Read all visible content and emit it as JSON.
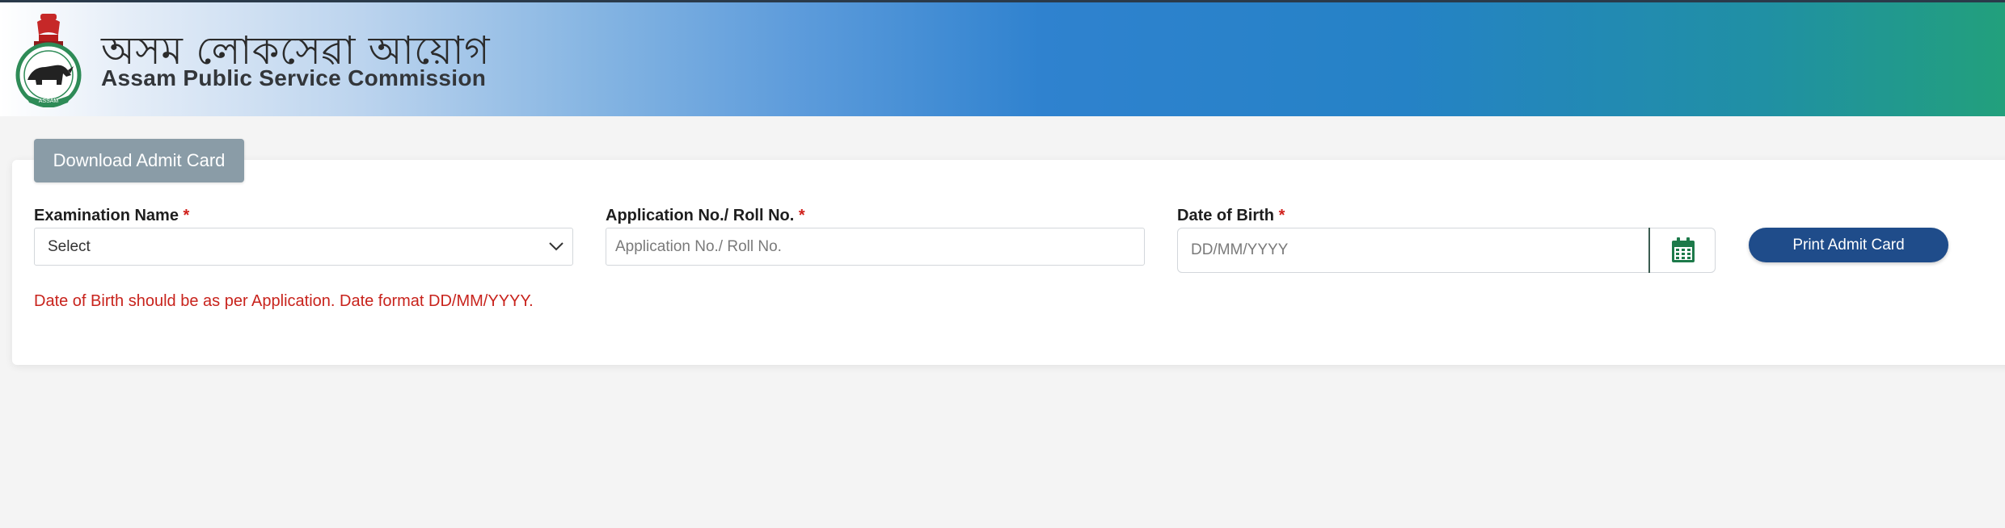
{
  "header": {
    "title_assamese": "অসম লোকসেৱা আয়োগ",
    "title_english": "Assam Public Service Commission",
    "logo_text": "ASSAM",
    "logo_icon": "state-emblem-icon"
  },
  "card": {
    "tab_label": "Download Admit Card"
  },
  "form": {
    "exam": {
      "label": "Examination Name",
      "required": "*",
      "selected": "Select",
      "icon": "chevron-down-icon"
    },
    "roll": {
      "label": "Application No./ Roll No.",
      "required": "*",
      "placeholder": "Application No./ Roll No."
    },
    "dob": {
      "label": "Date of Birth",
      "required": "*",
      "placeholder": "DD/MM/YYYY",
      "icon": "calendar-icon"
    },
    "print_label": "Print Admit Card",
    "hint": "Date of Birth should be as per Application. Date format DD/MM/YYYY."
  },
  "colors": {
    "primary_button": "#1f4c8a",
    "tab_bg": "#8a9ca7",
    "required": "#d0201b",
    "hint": "#c8231c",
    "calendar_icon": "#1d7a4a"
  }
}
